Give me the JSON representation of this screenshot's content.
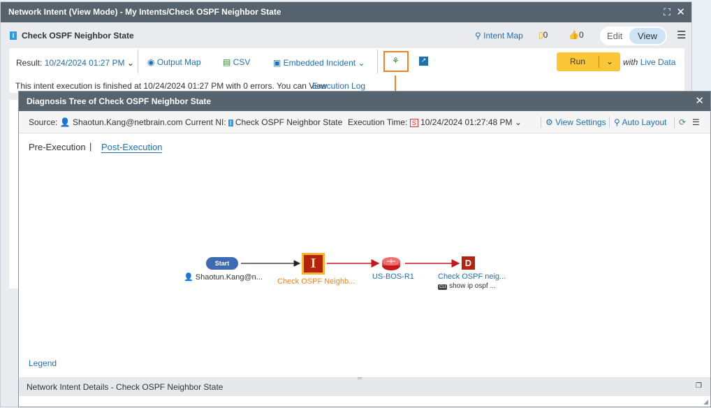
{
  "window": {
    "title": "Network Intent (View Mode) - My Intents/Check OSPF Neighbor State"
  },
  "header": {
    "intent_name": "Check OSPF Neighbor State",
    "intent_map": "Intent Map",
    "notes_count": "0",
    "likes_count": "0",
    "edit": "Edit",
    "view": "View"
  },
  "toolbar": {
    "result_label": "Result:",
    "result_value": "10/24/2024 01:27 PM",
    "output_map": "Output Map",
    "csv": "CSV",
    "embedded_incident": "Embedded Incident",
    "run": "Run",
    "with": "with",
    "live_data": "Live Data"
  },
  "status": {
    "message": "This intent execution is finished at 10/24/2024 01:27 PM with 0 errors. You can View",
    "execution_log": "Execution Log"
  },
  "dialog": {
    "title": "Diagnosis Tree of Check OSPF Neighbor State",
    "source_label": "Source:",
    "source_value": "Shaotun.Kang@netbrain.com",
    "current_ni_label": "Current NI:",
    "current_ni_value": "Check OSPF Neighbor State",
    "exec_time_label": "Execution Time:",
    "exec_time_value": "10/24/2024 01:27:48 PM",
    "view_settings": "View Settings",
    "auto_layout": "Auto Layout",
    "tabs": [
      {
        "label": "Pre-Execution",
        "active": false
      },
      {
        "label": "Post-Execution",
        "active": true
      }
    ],
    "tab_separator": "|",
    "tree": {
      "start": "Start",
      "start_user": "Shaotun.Kang@n...",
      "intent_node": "Check OSPF Neighb...",
      "intent_icon": "I",
      "device_node": "US-BOS-R1",
      "diag_node": "Check OSPF neig...",
      "diag_icon": "D",
      "cli_badge": "CLI",
      "cli_command": "show ip ospf ..."
    },
    "legend": "Legend",
    "details_title": "Network Intent Details - Check OSPF Neighbor State"
  },
  "colors": {
    "accent": "#1f6fb5",
    "run": "#fcc737",
    "highlight": "#f58220",
    "intent_node": "#b5220d",
    "edge": "#c8161d"
  }
}
